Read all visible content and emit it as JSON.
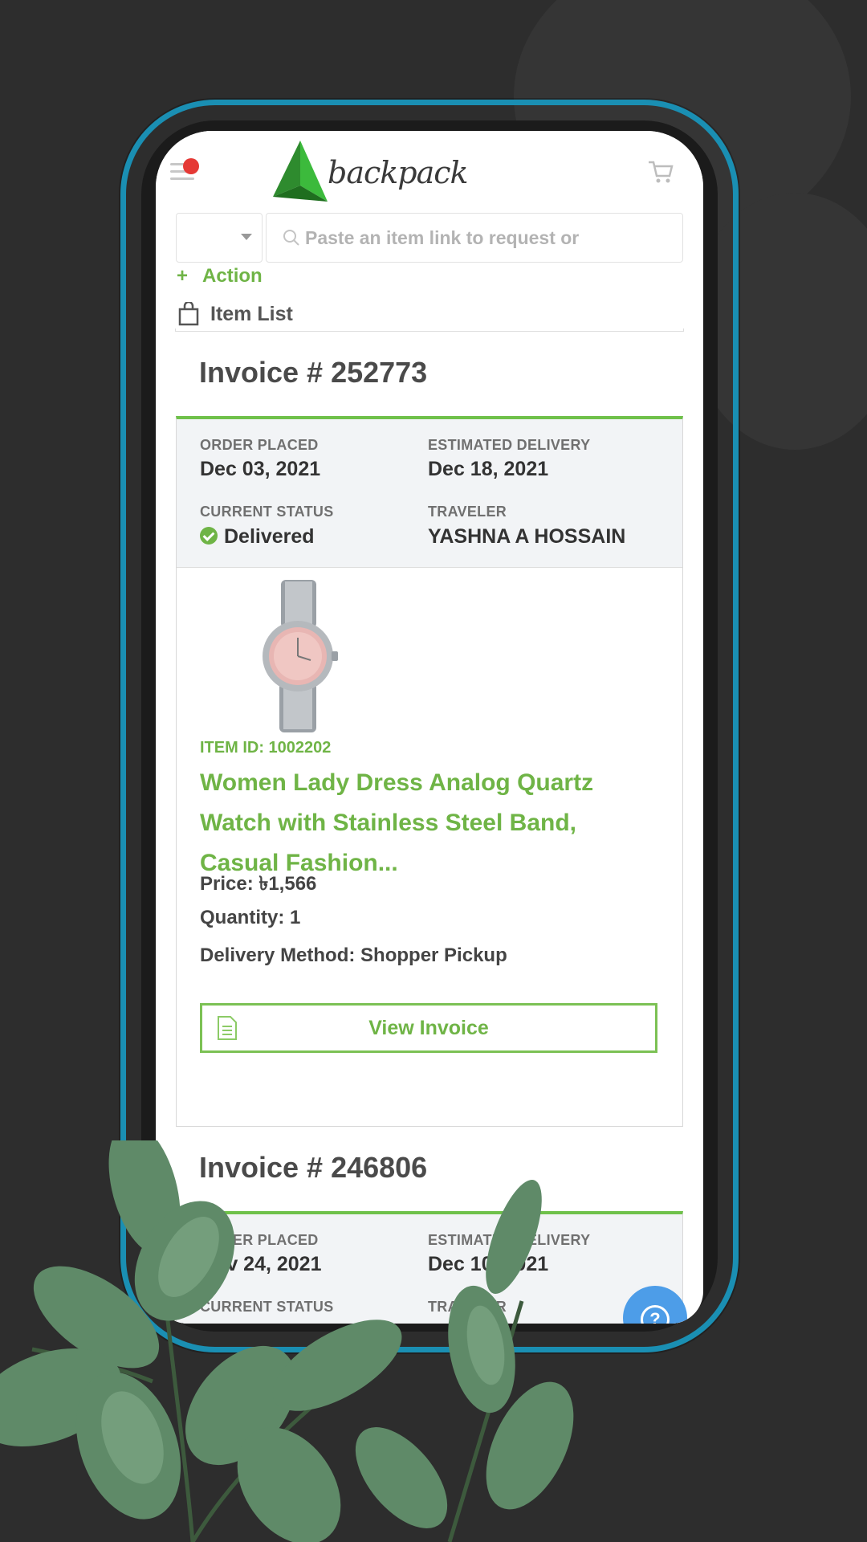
{
  "header": {
    "logo_text": "backpack",
    "language_value": "",
    "search_placeholder": "Paste an item link to request or"
  },
  "actions": {
    "action_label": "Action",
    "item_list_label": "Item List"
  },
  "invoices": [
    {
      "title": "Invoice # 252773",
      "order_placed_label": "ORDER PLACED",
      "order_placed": "Dec 03, 2021",
      "estimated_delivery_label": "ESTIMATED DELIVERY",
      "estimated_delivery": "Dec 18, 2021",
      "status_label": "CURRENT STATUS",
      "status": "Delivered",
      "traveler_label": "TRAVELER",
      "traveler": "YASHNA A HOSSAIN",
      "item_id": "ITEM ID: 1002202",
      "item_name": "Women Lady Dress Analog Quartz Watch with Stainless Steel Band, Casual Fashion...",
      "price": "Price: ৳1,566",
      "quantity": "Quantity: 1",
      "delivery_method": "Delivery Method: Shopper Pickup",
      "view_invoice_label": "View Invoice"
    },
    {
      "title": "Invoice # 246806",
      "order_placed_label": "ORDER PLACED",
      "order_placed": "Nov 24, 2021",
      "estimated_delivery_label": "ESTIMATED DELIVERY",
      "estimated_delivery": "Dec 10, 2021",
      "status_label": "CURRENT STATUS",
      "traveler_label": "TRAVELER"
    }
  ],
  "help_button": "?",
  "colors": {
    "accent_green": "#6fb446",
    "frame_blue": "#1a8fb3",
    "background": "#2d2d2d",
    "help_blue": "#4d9de8"
  }
}
